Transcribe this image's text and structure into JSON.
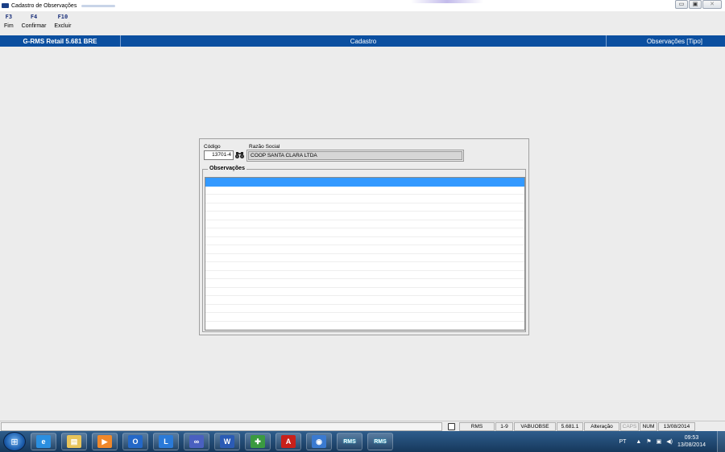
{
  "window": {
    "title": "Cadastro de Observações",
    "controls": {
      "minimize": "▭",
      "restore": "▣",
      "close": "✕"
    }
  },
  "toolbar": {
    "keys": [
      {
        "key": "F3",
        "label": "Fim"
      },
      {
        "key": "F4",
        "label": "Confirmar"
      },
      {
        "key": "F10",
        "label": "Excluir"
      }
    ]
  },
  "header": {
    "left": "G-RMS Retail 5.681 BRE",
    "center": "Cadastro",
    "right": "Observações [Tipo]"
  },
  "form": {
    "codigo_label": "Código",
    "codigo_value": "13701-4",
    "razao_label": "Razão Social",
    "razao_value": "COOP SANTA CLARA LTDA",
    "observacoes_title": "Observações",
    "observacoes_rows": [
      "",
      "",
      "",
      "",
      "",
      "",
      "",
      "",
      "",
      "",
      "",
      "",
      "",
      "",
      "",
      "",
      "",
      ""
    ]
  },
  "statusbar": {
    "system": "RMS",
    "range": "1-9",
    "program": "VABUOBSE",
    "version": "5.681.1",
    "mode": "Alteração",
    "caps": "CAPS",
    "num": "NUM",
    "date": "13/08/2014"
  },
  "taskbar": {
    "apps": [
      {
        "name": "ie",
        "glyph": "e",
        "color": "#2a8fe0"
      },
      {
        "name": "explorer",
        "glyph": "▤",
        "color": "#e8c45a"
      },
      {
        "name": "media",
        "glyph": "▶",
        "color": "#f0882a"
      },
      {
        "name": "outlook",
        "glyph": "O",
        "color": "#2468c8"
      },
      {
        "name": "lync",
        "glyph": "L",
        "color": "#2a7ad8"
      },
      {
        "name": "app-infinity",
        "glyph": "∞",
        "color": "#4a60c0"
      },
      {
        "name": "word",
        "glyph": "W",
        "color": "#2b5bb5"
      },
      {
        "name": "app-coins",
        "glyph": "✚",
        "color": "#3a9a40"
      },
      {
        "name": "acrobat",
        "glyph": "A",
        "color": "#c8201a"
      },
      {
        "name": "app-globe",
        "glyph": "◉",
        "color": "#3a7ad0"
      }
    ],
    "rms_label_1": "RMS",
    "rms_label_2": "RMS",
    "lang": "PT",
    "time": "09:53",
    "date": "13/08/2014"
  }
}
